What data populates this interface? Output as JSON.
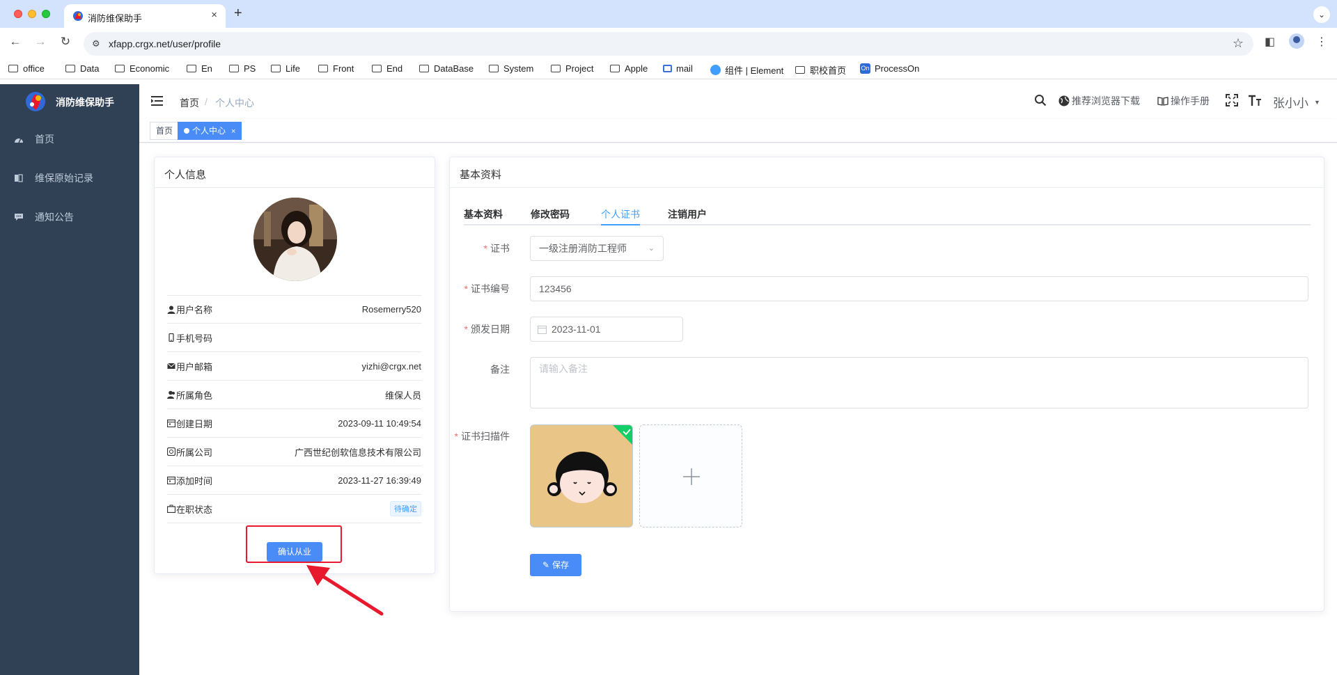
{
  "browser": {
    "tab_title": "消防维保助手",
    "new_tab": "+",
    "tab_close": "×",
    "url": "xfapp.crgx.net/user/profile",
    "bookmarks": [
      "office",
      "Data",
      "Economic",
      "En",
      "PS",
      "Life",
      "Front",
      "End",
      "DataBase",
      "System",
      "Project",
      "Apple",
      "mail",
      "组件 | Element",
      "职校首页",
      "ProcessOn"
    ]
  },
  "sidebar": {
    "brand": "消防维保助手",
    "items": [
      {
        "label": "首页",
        "icon": "dashboard-icon"
      },
      {
        "label": "维保原始记录",
        "icon": "book-icon"
      },
      {
        "label": "通知公告",
        "icon": "message-icon"
      }
    ]
  },
  "navbar": {
    "breadcrumb_home": "首页",
    "breadcrumb_sep": "/",
    "breadcrumb_current": "个人中心",
    "browser_download": "推荐浏览器下载",
    "manual": "操作手册",
    "username": "张小小"
  },
  "tagsview": {
    "tags": [
      {
        "label": "首页",
        "active": false
      },
      {
        "label": "个人中心",
        "active": true
      }
    ],
    "close": "×"
  },
  "profile": {
    "header": "个人信息",
    "rows": [
      {
        "label": "用户名称",
        "value": "Rosemerry520",
        "icon": "user-icon"
      },
      {
        "label": "手机号码",
        "value": "",
        "icon": "phone-icon"
      },
      {
        "label": "用户邮箱",
        "value": "yizhi@crgx.net",
        "icon": "mail-icon"
      },
      {
        "label": "所属角色",
        "value": "维保人员",
        "icon": "peoples-icon"
      },
      {
        "label": "创建日期",
        "value": "2023-09-11 10:49:54",
        "icon": "date-icon"
      },
      {
        "label": "所属公司",
        "value": "广西世纪创软信息技术有限公司",
        "icon": "company-icon"
      },
      {
        "label": "添加时间",
        "value": "2023-11-27 16:39:49",
        "icon": "date-icon"
      },
      {
        "label": "在职状态",
        "value": "待确定",
        "icon": "job-icon"
      }
    ],
    "confirm_button": "确认从业"
  },
  "basic": {
    "header": "基本资料",
    "tabs": [
      "基本资料",
      "修改密码",
      "个人证书",
      "注销用户"
    ],
    "active_tab": 2,
    "form": {
      "cert_label": "证书",
      "cert_value": "一级注册消防工程师",
      "cert_no_label": "证书编号",
      "cert_no_value": "123456",
      "issue_date_label": "颁发日期",
      "issue_date_value": "2023-11-01",
      "remark_label": "备注",
      "remark_placeholder": "请输入备注",
      "scan_label": "证书扫描件",
      "required_mark": "*",
      "save_button": "保存"
    }
  },
  "colors": {
    "sidebar_bg": "#304156",
    "primary": "#409eff",
    "button": "#4a8cf7",
    "annotation_red": "#e8192c"
  }
}
